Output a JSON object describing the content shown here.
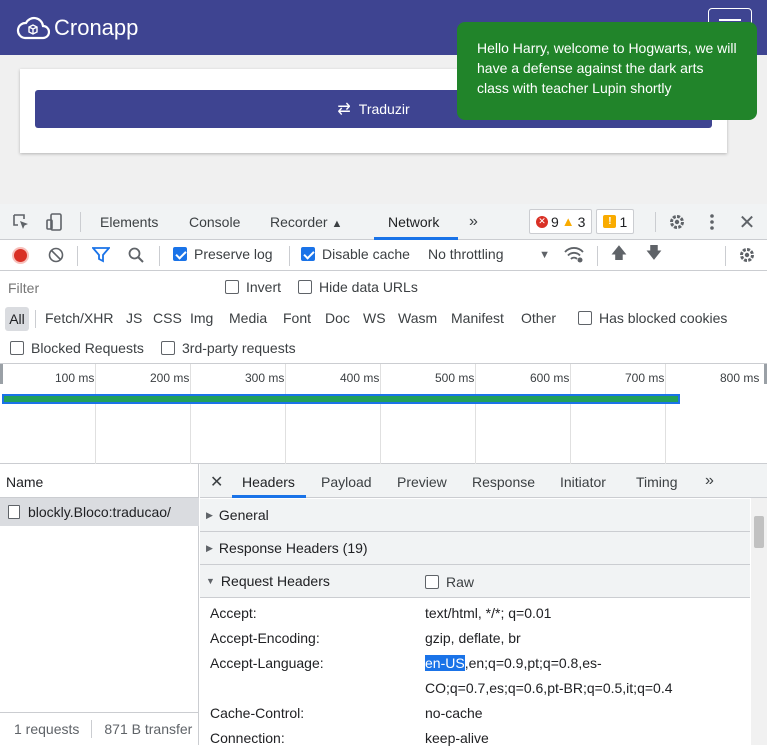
{
  "app": {
    "brand": "Cronapp",
    "translate_button": "Traduzir",
    "toast": "Hello Harry, welcome to Hogwarts, we will have a defense against the dark arts class with teacher Lupin shortly"
  },
  "devtools": {
    "tabs": [
      "Elements",
      "Console",
      "Recorder",
      "Network"
    ],
    "more_tabs": "»",
    "badges": {
      "errors": "9",
      "warnings": "3",
      "issues": "1"
    },
    "toolbar": {
      "preserve_log": "Preserve log",
      "disable_cache": "Disable cache",
      "throttling": "No throttling"
    },
    "filter": {
      "placeholder": "Filter",
      "invert": "Invert",
      "hide_data_urls": "Hide data URLs"
    },
    "types": [
      "All",
      "Fetch/XHR",
      "JS",
      "CSS",
      "Img",
      "Media",
      "Font",
      "Doc",
      "WS",
      "Wasm",
      "Manifest",
      "Other"
    ],
    "has_blocked_cookies": "Has blocked cookies",
    "blocked_requests": "Blocked Requests",
    "third_party": "3rd-party requests",
    "timeline_ticks": [
      "100 ms",
      "200 ms",
      "300 ms",
      "400 ms",
      "500 ms",
      "600 ms",
      "700 ms",
      "800 ms"
    ],
    "name_header": "Name",
    "request_name": "blockly.Bloco:traducao/",
    "status": {
      "requests": "1 requests",
      "transfer": "871 B transfer"
    },
    "detail_tabs": [
      "Headers",
      "Payload",
      "Preview",
      "Response",
      "Initiator",
      "Timing"
    ],
    "sections": {
      "general": "General",
      "response_headers": "Response Headers (19)",
      "request_headers": "Request Headers",
      "raw": "Raw"
    },
    "request_headers": [
      {
        "key": "Accept:",
        "value": "text/html, */*; q=0.01"
      },
      {
        "key": "Accept-Encoding:",
        "value": "gzip, deflate, br"
      },
      {
        "key": "Accept-Language:",
        "value_selected": "en-US",
        "value": ",en;q=0.9,pt;q=0.8,es-",
        "value_line2": "CO;q=0.7,es;q=0.6,pt-BR;q=0.5,it;q=0.4"
      },
      {
        "key": "Cache-Control:",
        "value": "no-cache"
      },
      {
        "key": "Connection:",
        "value": "keep-alive"
      }
    ]
  }
}
